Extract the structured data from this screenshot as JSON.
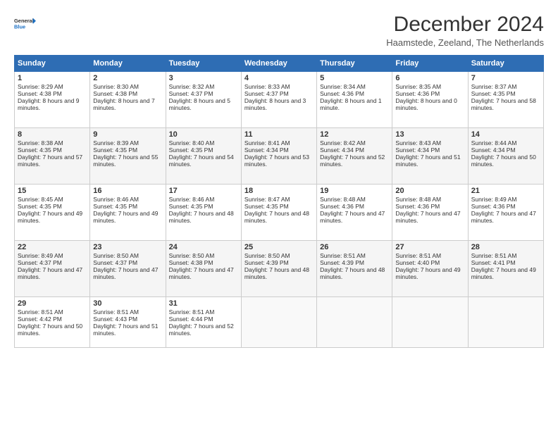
{
  "logo": {
    "line1": "General",
    "line2": "Blue"
  },
  "title": "December 2024",
  "subtitle": "Haamstede, Zeeland, The Netherlands",
  "days_of_week": [
    "Sunday",
    "Monday",
    "Tuesday",
    "Wednesday",
    "Thursday",
    "Friday",
    "Saturday"
  ],
  "weeks": [
    [
      {
        "day": "1",
        "sunrise": "8:29 AM",
        "sunset": "4:38 PM",
        "daylight": "8 hours and 9 minutes."
      },
      {
        "day": "2",
        "sunrise": "8:30 AM",
        "sunset": "4:38 PM",
        "daylight": "8 hours and 7 minutes."
      },
      {
        "day": "3",
        "sunrise": "8:32 AM",
        "sunset": "4:37 PM",
        "daylight": "8 hours and 5 minutes."
      },
      {
        "day": "4",
        "sunrise": "8:33 AM",
        "sunset": "4:37 PM",
        "daylight": "8 hours and 3 minutes."
      },
      {
        "day": "5",
        "sunrise": "8:34 AM",
        "sunset": "4:36 PM",
        "daylight": "8 hours and 1 minute."
      },
      {
        "day": "6",
        "sunrise": "8:35 AM",
        "sunset": "4:36 PM",
        "daylight": "8 hours and 0 minutes."
      },
      {
        "day": "7",
        "sunrise": "8:37 AM",
        "sunset": "4:35 PM",
        "daylight": "7 hours and 58 minutes."
      }
    ],
    [
      {
        "day": "8",
        "sunrise": "8:38 AM",
        "sunset": "4:35 PM",
        "daylight": "7 hours and 57 minutes."
      },
      {
        "day": "9",
        "sunrise": "8:39 AM",
        "sunset": "4:35 PM",
        "daylight": "7 hours and 55 minutes."
      },
      {
        "day": "10",
        "sunrise": "8:40 AM",
        "sunset": "4:35 PM",
        "daylight": "7 hours and 54 minutes."
      },
      {
        "day": "11",
        "sunrise": "8:41 AM",
        "sunset": "4:34 PM",
        "daylight": "7 hours and 53 minutes."
      },
      {
        "day": "12",
        "sunrise": "8:42 AM",
        "sunset": "4:34 PM",
        "daylight": "7 hours and 52 minutes."
      },
      {
        "day": "13",
        "sunrise": "8:43 AM",
        "sunset": "4:34 PM",
        "daylight": "7 hours and 51 minutes."
      },
      {
        "day": "14",
        "sunrise": "8:44 AM",
        "sunset": "4:34 PM",
        "daylight": "7 hours and 50 minutes."
      }
    ],
    [
      {
        "day": "15",
        "sunrise": "8:45 AM",
        "sunset": "4:35 PM",
        "daylight": "7 hours and 49 minutes."
      },
      {
        "day": "16",
        "sunrise": "8:46 AM",
        "sunset": "4:35 PM",
        "daylight": "7 hours and 49 minutes."
      },
      {
        "day": "17",
        "sunrise": "8:46 AM",
        "sunset": "4:35 PM",
        "daylight": "7 hours and 48 minutes."
      },
      {
        "day": "18",
        "sunrise": "8:47 AM",
        "sunset": "4:35 PM",
        "daylight": "7 hours and 48 minutes."
      },
      {
        "day": "19",
        "sunrise": "8:48 AM",
        "sunset": "4:36 PM",
        "daylight": "7 hours and 47 minutes."
      },
      {
        "day": "20",
        "sunrise": "8:48 AM",
        "sunset": "4:36 PM",
        "daylight": "7 hours and 47 minutes."
      },
      {
        "day": "21",
        "sunrise": "8:49 AM",
        "sunset": "4:36 PM",
        "daylight": "7 hours and 47 minutes."
      }
    ],
    [
      {
        "day": "22",
        "sunrise": "8:49 AM",
        "sunset": "4:37 PM",
        "daylight": "7 hours and 47 minutes."
      },
      {
        "day": "23",
        "sunrise": "8:50 AM",
        "sunset": "4:37 PM",
        "daylight": "7 hours and 47 minutes."
      },
      {
        "day": "24",
        "sunrise": "8:50 AM",
        "sunset": "4:38 PM",
        "daylight": "7 hours and 47 minutes."
      },
      {
        "day": "25",
        "sunrise": "8:50 AM",
        "sunset": "4:39 PM",
        "daylight": "7 hours and 48 minutes."
      },
      {
        "day": "26",
        "sunrise": "8:51 AM",
        "sunset": "4:39 PM",
        "daylight": "7 hours and 48 minutes."
      },
      {
        "day": "27",
        "sunrise": "8:51 AM",
        "sunset": "4:40 PM",
        "daylight": "7 hours and 49 minutes."
      },
      {
        "day": "28",
        "sunrise": "8:51 AM",
        "sunset": "4:41 PM",
        "daylight": "7 hours and 49 minutes."
      }
    ],
    [
      {
        "day": "29",
        "sunrise": "8:51 AM",
        "sunset": "4:42 PM",
        "daylight": "7 hours and 50 minutes."
      },
      {
        "day": "30",
        "sunrise": "8:51 AM",
        "sunset": "4:43 PM",
        "daylight": "7 hours and 51 minutes."
      },
      {
        "day": "31",
        "sunrise": "8:51 AM",
        "sunset": "4:44 PM",
        "daylight": "7 hours and 52 minutes."
      },
      null,
      null,
      null,
      null
    ]
  ]
}
